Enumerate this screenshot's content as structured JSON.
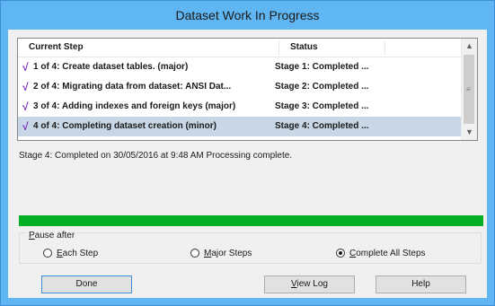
{
  "window": {
    "title": "Dataset Work In Progress"
  },
  "list": {
    "columns": {
      "step": "Current Step",
      "status": "Status"
    },
    "rows": [
      {
        "step": "1 of 4: Create dataset tables. (major)",
        "status": "Stage 1: Completed ...",
        "checked": true,
        "selected": false
      },
      {
        "step": "2 of 4: Migrating data from dataset: ANSI Dat...",
        "status": "Stage 2: Completed ...",
        "checked": true,
        "selected": false
      },
      {
        "step": "3 of 4: Adding indexes and foreign keys (major)",
        "status": "Stage 3: Completed ...",
        "checked": true,
        "selected": false
      },
      {
        "step": "4 of 4: Completing dataset creation (minor)",
        "status": "Stage 4: Completed ...",
        "checked": true,
        "selected": true
      }
    ],
    "check_glyph": "√",
    "scroll_up_glyph": "▲",
    "scroll_down_glyph": "▼",
    "scroll_grip_glyph": "≡"
  },
  "message": "Stage 4: Completed on 30/05/2016 at 9:48 AM Processing complete.",
  "progress": {
    "percent": 100,
    "color": "#06b025"
  },
  "pause_after": {
    "legend_accel": "P",
    "legend_rest": "ause after",
    "options": [
      {
        "accel": "E",
        "rest": "ach Step",
        "selected": false
      },
      {
        "accel": "M",
        "rest": "ajor Steps",
        "selected": false
      },
      {
        "accel": "C",
        "rest": "omplete All Steps",
        "selected": true
      }
    ]
  },
  "buttons": {
    "done": "Done",
    "view_log_accel": "V",
    "view_log_rest": "iew Log",
    "help": "Help"
  },
  "colors": {
    "titlebar": "#60b6f2",
    "selected_row": "#c8d7e6",
    "check": "#7a2bb8"
  }
}
